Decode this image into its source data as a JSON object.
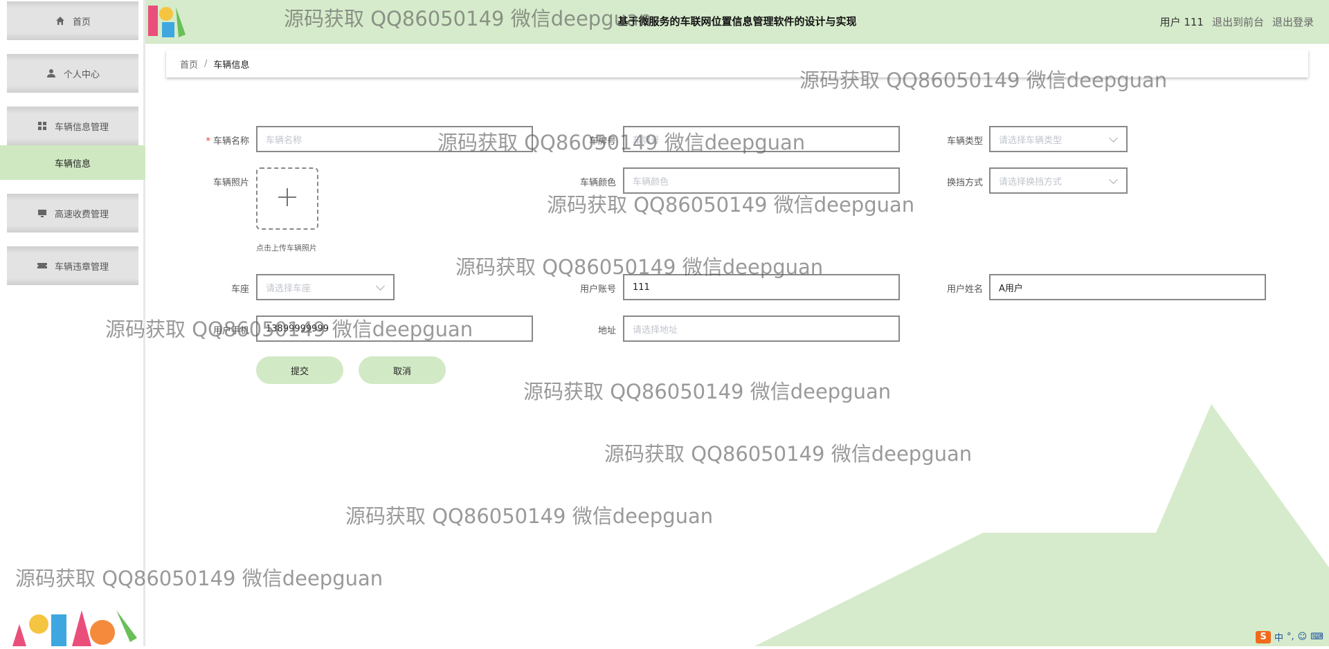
{
  "header": {
    "title": "基于微服务的车联网位置信息管理软件的设计与实现",
    "user_label": "用户 111",
    "front_link": "退出到前台",
    "logout_link": "退出登录"
  },
  "sidebar": {
    "items": [
      {
        "label": "首页",
        "icon": "home-icon"
      },
      {
        "label": "个人中心",
        "icon": "user-icon"
      },
      {
        "label": "车辆信息管理",
        "icon": "grid-icon"
      },
      {
        "label": "高速收费管理",
        "icon": "monitor-icon"
      },
      {
        "label": "车辆违章管理",
        "icon": "ticket-icon"
      }
    ],
    "sub_item": "车辆信息"
  },
  "breadcrumb": {
    "home": "首页",
    "separator": "/",
    "current": "车辆信息"
  },
  "form": {
    "vehicle_name": {
      "label": "车辆名称",
      "placeholder": "车辆名称"
    },
    "plate": {
      "label": "车牌号",
      "placeholder": "车牌号"
    },
    "vehicle_type": {
      "label": "车辆类型",
      "placeholder": "请选择车辆类型"
    },
    "photo": {
      "label": "车辆照片",
      "tip": "点击上传车辆照片"
    },
    "color": {
      "label": "车辆颜色",
      "placeholder": "车辆颜色"
    },
    "gear": {
      "label": "换挡方式",
      "placeholder": "请选择换挡方式"
    },
    "seats": {
      "label": "车座",
      "placeholder": "请选择车座"
    },
    "account": {
      "label": "用户账号",
      "value": "111"
    },
    "username": {
      "label": "用户姓名",
      "value": "A用户"
    },
    "phone": {
      "label": "用户手机",
      "value": "13899999999"
    },
    "address": {
      "label": "地址",
      "placeholder": "请选择地址"
    },
    "submit": "提交",
    "cancel": "取消"
  },
  "watermark_text": "源码获取 QQ86050149 微信deepguan",
  "ime": {
    "lang": "中",
    "punct": "°,"
  },
  "colors": {
    "accent": "#d6ebcb",
    "sidebar_active": "#cfe8c2",
    "required": "#e33333"
  }
}
